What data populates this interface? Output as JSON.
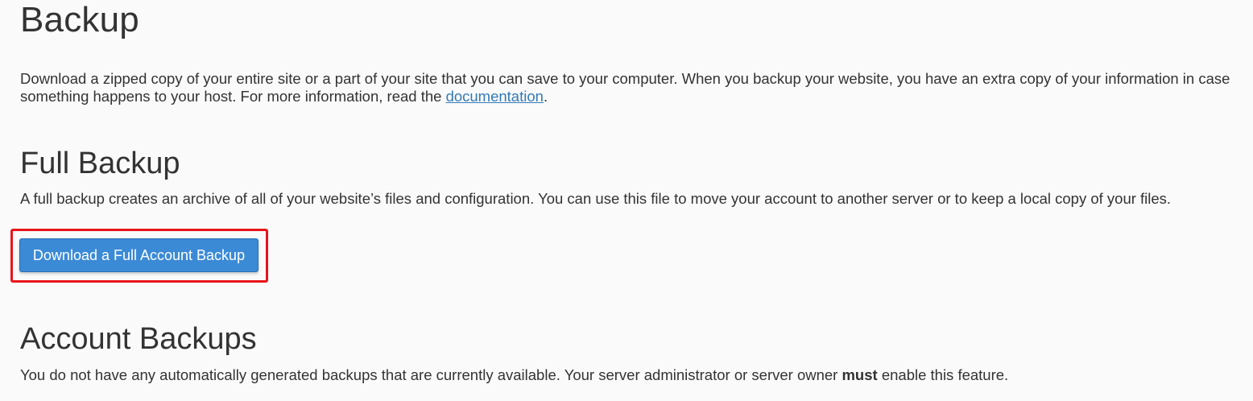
{
  "page": {
    "title": "Backup"
  },
  "intro": {
    "text_before_link": "Download a zipped copy of your entire site or a part of your site that you can save to your computer. When you backup your website, you have an extra copy of your information in case something happens to your host. For more information, read the ",
    "link_label": "documentation",
    "text_after_link": "."
  },
  "full_backup": {
    "heading": "Full Backup",
    "description": "A full backup creates an archive of all of your website’s files and configuration. You can use this file to move your account to another server or to keep a local copy of your files.",
    "button_label": "Download a Full Account Backup"
  },
  "account_backups": {
    "heading": "Account Backups",
    "description_before_bold": "You do not have any automatically generated backups that are currently available. Your server administrator or server owner ",
    "description_bold": "must",
    "description_after_bold": " enable this feature."
  },
  "colors": {
    "background": "#fafafa",
    "text": "#333333",
    "link": "#337ab7",
    "button": "#3b8ad6",
    "highlight": "#e8141b"
  }
}
